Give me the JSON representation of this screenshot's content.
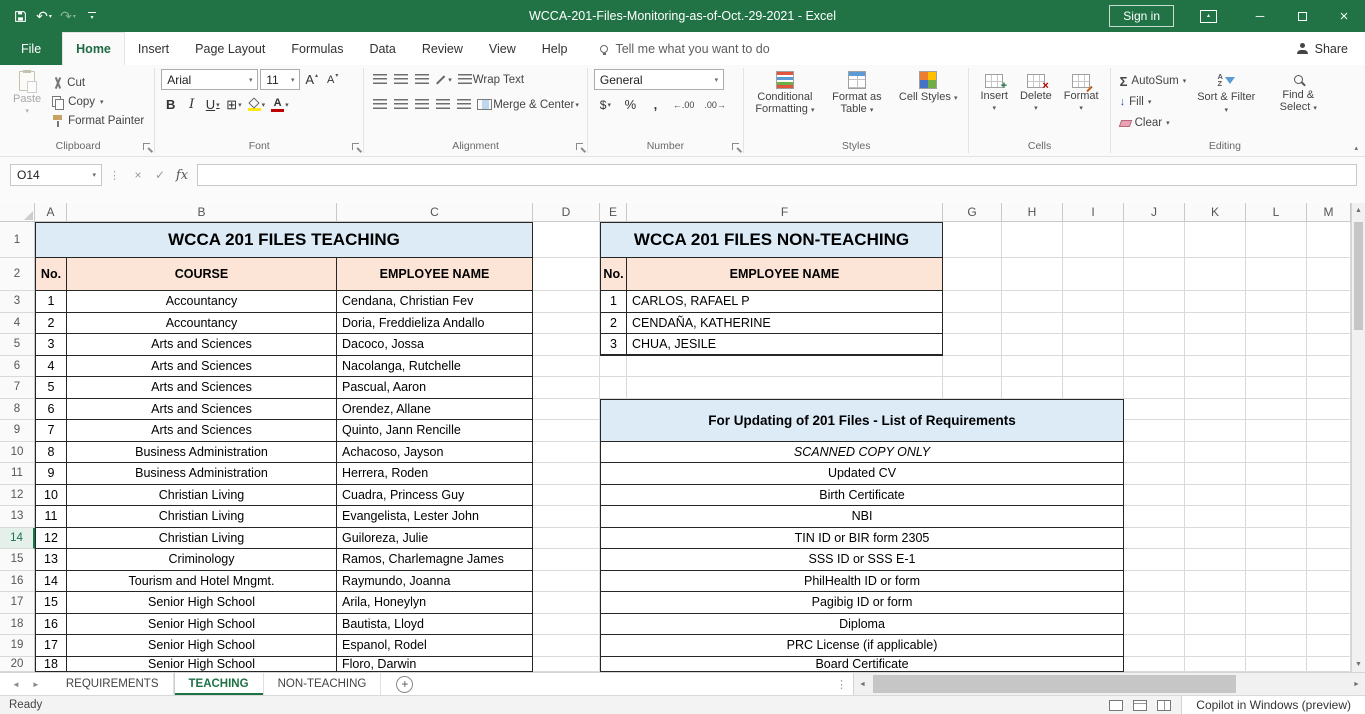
{
  "title_bar": {
    "title": "WCCA-201-Files-Monitoring-as-of-Oct.-29-2021 - Excel",
    "sign_in": "Sign in"
  },
  "tab_row": {
    "file": "File",
    "tabs": [
      "Home",
      "Insert",
      "Page Layout",
      "Formulas",
      "Data",
      "Review",
      "View",
      "Help"
    ],
    "active": "Home",
    "tell_me": "Tell me what you want to do",
    "share": "Share"
  },
  "ribbon": {
    "clipboard": {
      "label": "Clipboard",
      "paste": "Paste",
      "cut": "Cut",
      "copy": "Copy",
      "format_painter": "Format Painter"
    },
    "font": {
      "label": "Font",
      "family": "Arial",
      "size": "11"
    },
    "alignment": {
      "label": "Alignment",
      "wrap_text": "Wrap Text",
      "merge_center": "Merge & Center"
    },
    "number": {
      "label": "Number",
      "format": "General"
    },
    "styles": {
      "label": "Styles",
      "conditional_formatting": "Conditional Formatting",
      "format_as_table": "Format as Table",
      "cell_styles": "Cell Styles"
    },
    "cells": {
      "label": "Cells",
      "insert": "Insert",
      "delete": "Delete",
      "format": "Format"
    },
    "editing": {
      "label": "Editing",
      "autosum": "AutoSum",
      "fill": "Fill",
      "clear": "Clear",
      "sort_filter": "Sort & Filter",
      "find_select": "Find & Select"
    }
  },
  "formula_bar": {
    "name_box": "O14",
    "fx": "fx"
  },
  "grid": {
    "columns": [
      "A",
      "B",
      "C",
      "D",
      "E",
      "F",
      "G",
      "H",
      "I",
      "J",
      "K",
      "L",
      "M"
    ],
    "rows": [
      "1",
      "2",
      "3",
      "4",
      "5",
      "6",
      "7",
      "8",
      "9",
      "10",
      "11",
      "12",
      "13",
      "14",
      "15",
      "16",
      "17",
      "18",
      "19",
      "20"
    ],
    "selected_row": "14"
  },
  "teaching_table": {
    "title": "WCCA 201 FILES TEACHING",
    "headers": [
      "No.",
      "COURSE",
      "EMPLOYEE NAME"
    ],
    "rows": [
      [
        1,
        "Accountancy",
        "Cendana, Christian Fev"
      ],
      [
        2,
        "Accountancy",
        "Doria, Freddieliza Andallo"
      ],
      [
        3,
        "Arts and Sciences",
        "Dacoco, Jossa"
      ],
      [
        4,
        "Arts and Sciences",
        "Nacolanga, Rutchelle"
      ],
      [
        5,
        "Arts and Sciences",
        "Pascual, Aaron"
      ],
      [
        6,
        "Arts and Sciences",
        "Orendez, Allane"
      ],
      [
        7,
        "Arts and Sciences",
        "Quinto, Jann Rencille"
      ],
      [
        8,
        "Business Administration",
        "Achacoso, Jayson"
      ],
      [
        9,
        "Business Administration",
        "Herrera, Roden"
      ],
      [
        10,
        "Christian Living",
        "Cuadra, Princess Guy"
      ],
      [
        11,
        "Christian Living",
        "Evangelista, Lester John"
      ],
      [
        12,
        "Christian Living",
        "Guiloreza, Julie"
      ],
      [
        13,
        "Criminology",
        "Ramos, Charlemagne James"
      ],
      [
        14,
        "Tourism and Hotel Mngmt.",
        "Raymundo, Joanna"
      ],
      [
        15,
        "Senior High School",
        "Arila, Honeylyn"
      ],
      [
        16,
        "Senior High School",
        "Bautista, Lloyd"
      ],
      [
        17,
        "Senior High School",
        "Espanol, Rodel"
      ],
      [
        18,
        "Senior High School",
        "Floro, Darwin"
      ]
    ]
  },
  "non_teaching_table": {
    "title": "WCCA 201 FILES NON-TEACHING",
    "headers": [
      "No.",
      "EMPLOYEE NAME"
    ],
    "rows": [
      [
        1,
        "CARLOS, RAFAEL P"
      ],
      [
        2,
        "CENDAÑA, KATHERINE"
      ],
      [
        3,
        "CHUA, JESILE"
      ]
    ]
  },
  "requirements_table": {
    "title": "For Updating of 201 Files - List of Requirements",
    "items": [
      "SCANNED COPY ONLY",
      "Updated CV",
      "Birth Certificate",
      "NBI",
      "TIN ID or BIR form 2305",
      "SSS ID or SSS E-1",
      "PhilHealth ID or form",
      "Pagibig ID or form",
      "Diploma",
      "PRC License (if applicable)",
      "Board Certificate"
    ]
  },
  "sheet_tabs": {
    "tabs": [
      "REQUIREMENTS",
      "TEACHING",
      "NON-TEACHING"
    ],
    "active": "TEACHING"
  },
  "status_bar": {
    "mode": "Ready",
    "copilot": "Copilot in Windows (preview)"
  },
  "colors": {
    "excel_green": "#217346",
    "table_title_fill": "#DDEBF7",
    "table_header_fill": "#FCE4D6",
    "active_sheet_tab_text": "#1E7145"
  },
  "glyphs": {
    "caret_down": "▾",
    "caret_up": "▴",
    "arrow_up": "▲",
    "arrow_down": "▼",
    "arrow_left": "◄",
    "arrow_right": "►",
    "undo": "↶",
    "redo": "↷",
    "close": "×",
    "minimize": "─",
    "check": "✓",
    "cancel": "×",
    "dots_vertical": "⋮",
    "sigma": "Σ",
    "plus": "+",
    "bold": "B",
    "italic": "I",
    "underline": "U",
    "border": "⊞",
    "dollar": "$",
    "percent": "%",
    "comma": ",",
    "increase_decimal": "←.00",
    "decrease_decimal": ".00→",
    "grow_font": "A",
    "shrink_font": "A",
    "fill_arrow": "↓",
    "sort_a": "A",
    "sort_z": "Z"
  }
}
